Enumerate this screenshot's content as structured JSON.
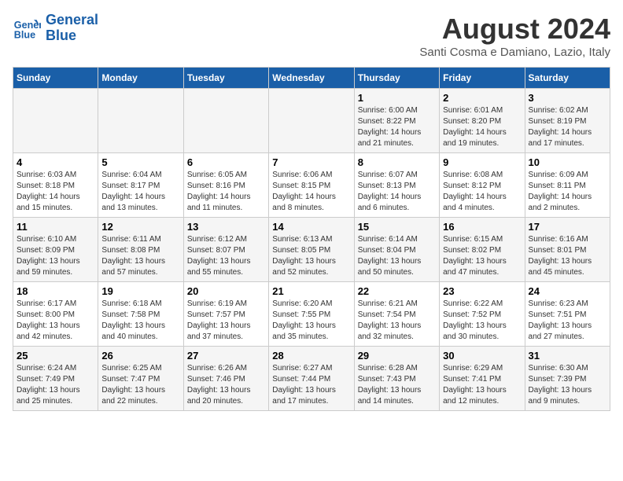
{
  "header": {
    "logo_line1": "General",
    "logo_line2": "Blue",
    "month_year": "August 2024",
    "location": "Santi Cosma e Damiano, Lazio, Italy"
  },
  "weekdays": [
    "Sunday",
    "Monday",
    "Tuesday",
    "Wednesday",
    "Thursday",
    "Friday",
    "Saturday"
  ],
  "weeks": [
    [
      {
        "day": "",
        "info": ""
      },
      {
        "day": "",
        "info": ""
      },
      {
        "day": "",
        "info": ""
      },
      {
        "day": "",
        "info": ""
      },
      {
        "day": "1",
        "info": "Sunrise: 6:00 AM\nSunset: 8:22 PM\nDaylight: 14 hours\nand 21 minutes."
      },
      {
        "day": "2",
        "info": "Sunrise: 6:01 AM\nSunset: 8:20 PM\nDaylight: 14 hours\nand 19 minutes."
      },
      {
        "day": "3",
        "info": "Sunrise: 6:02 AM\nSunset: 8:19 PM\nDaylight: 14 hours\nand 17 minutes."
      }
    ],
    [
      {
        "day": "4",
        "info": "Sunrise: 6:03 AM\nSunset: 8:18 PM\nDaylight: 14 hours\nand 15 minutes."
      },
      {
        "day": "5",
        "info": "Sunrise: 6:04 AM\nSunset: 8:17 PM\nDaylight: 14 hours\nand 13 minutes."
      },
      {
        "day": "6",
        "info": "Sunrise: 6:05 AM\nSunset: 8:16 PM\nDaylight: 14 hours\nand 11 minutes."
      },
      {
        "day": "7",
        "info": "Sunrise: 6:06 AM\nSunset: 8:15 PM\nDaylight: 14 hours\nand 8 minutes."
      },
      {
        "day": "8",
        "info": "Sunrise: 6:07 AM\nSunset: 8:13 PM\nDaylight: 14 hours\nand 6 minutes."
      },
      {
        "day": "9",
        "info": "Sunrise: 6:08 AM\nSunset: 8:12 PM\nDaylight: 14 hours\nand 4 minutes."
      },
      {
        "day": "10",
        "info": "Sunrise: 6:09 AM\nSunset: 8:11 PM\nDaylight: 14 hours\nand 2 minutes."
      }
    ],
    [
      {
        "day": "11",
        "info": "Sunrise: 6:10 AM\nSunset: 8:09 PM\nDaylight: 13 hours\nand 59 minutes."
      },
      {
        "day": "12",
        "info": "Sunrise: 6:11 AM\nSunset: 8:08 PM\nDaylight: 13 hours\nand 57 minutes."
      },
      {
        "day": "13",
        "info": "Sunrise: 6:12 AM\nSunset: 8:07 PM\nDaylight: 13 hours\nand 55 minutes."
      },
      {
        "day": "14",
        "info": "Sunrise: 6:13 AM\nSunset: 8:05 PM\nDaylight: 13 hours\nand 52 minutes."
      },
      {
        "day": "15",
        "info": "Sunrise: 6:14 AM\nSunset: 8:04 PM\nDaylight: 13 hours\nand 50 minutes."
      },
      {
        "day": "16",
        "info": "Sunrise: 6:15 AM\nSunset: 8:02 PM\nDaylight: 13 hours\nand 47 minutes."
      },
      {
        "day": "17",
        "info": "Sunrise: 6:16 AM\nSunset: 8:01 PM\nDaylight: 13 hours\nand 45 minutes."
      }
    ],
    [
      {
        "day": "18",
        "info": "Sunrise: 6:17 AM\nSunset: 8:00 PM\nDaylight: 13 hours\nand 42 minutes."
      },
      {
        "day": "19",
        "info": "Sunrise: 6:18 AM\nSunset: 7:58 PM\nDaylight: 13 hours\nand 40 minutes."
      },
      {
        "day": "20",
        "info": "Sunrise: 6:19 AM\nSunset: 7:57 PM\nDaylight: 13 hours\nand 37 minutes."
      },
      {
        "day": "21",
        "info": "Sunrise: 6:20 AM\nSunset: 7:55 PM\nDaylight: 13 hours\nand 35 minutes."
      },
      {
        "day": "22",
        "info": "Sunrise: 6:21 AM\nSunset: 7:54 PM\nDaylight: 13 hours\nand 32 minutes."
      },
      {
        "day": "23",
        "info": "Sunrise: 6:22 AM\nSunset: 7:52 PM\nDaylight: 13 hours\nand 30 minutes."
      },
      {
        "day": "24",
        "info": "Sunrise: 6:23 AM\nSunset: 7:51 PM\nDaylight: 13 hours\nand 27 minutes."
      }
    ],
    [
      {
        "day": "25",
        "info": "Sunrise: 6:24 AM\nSunset: 7:49 PM\nDaylight: 13 hours\nand 25 minutes."
      },
      {
        "day": "26",
        "info": "Sunrise: 6:25 AM\nSunset: 7:47 PM\nDaylight: 13 hours\nand 22 minutes."
      },
      {
        "day": "27",
        "info": "Sunrise: 6:26 AM\nSunset: 7:46 PM\nDaylight: 13 hours\nand 20 minutes."
      },
      {
        "day": "28",
        "info": "Sunrise: 6:27 AM\nSunset: 7:44 PM\nDaylight: 13 hours\nand 17 minutes."
      },
      {
        "day": "29",
        "info": "Sunrise: 6:28 AM\nSunset: 7:43 PM\nDaylight: 13 hours\nand 14 minutes."
      },
      {
        "day": "30",
        "info": "Sunrise: 6:29 AM\nSunset: 7:41 PM\nDaylight: 13 hours\nand 12 minutes."
      },
      {
        "day": "31",
        "info": "Sunrise: 6:30 AM\nSunset: 7:39 PM\nDaylight: 13 hours\nand 9 minutes."
      }
    ]
  ]
}
